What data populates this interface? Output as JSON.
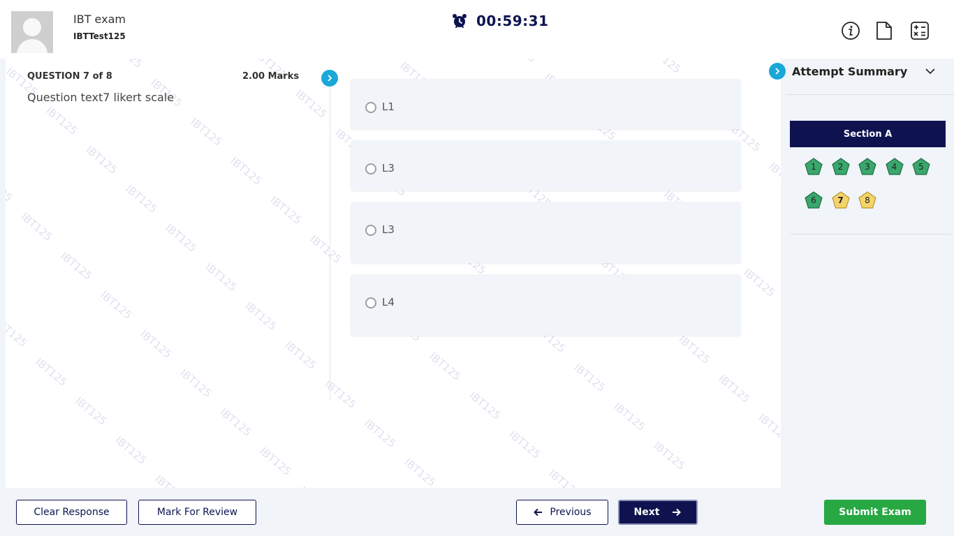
{
  "header": {
    "exam_name": "IBT exam",
    "test_id": "IBTTest125",
    "timer": "00:59:31",
    "icons": [
      "info-icon",
      "document-icon",
      "calculator-icon"
    ]
  },
  "question": {
    "label": "QUESTION 7 of 8",
    "marks": "2.00 Marks",
    "text": "Question text7 likert scale",
    "options": [
      "L1",
      "L3",
      "L3",
      "L4"
    ]
  },
  "watermark": "IBT125",
  "summary": {
    "title": "Attempt Summary",
    "section": "Section A",
    "questions": [
      {
        "n": "1",
        "status": "answered"
      },
      {
        "n": "2",
        "status": "answered"
      },
      {
        "n": "3",
        "status": "answered"
      },
      {
        "n": "4",
        "status": "answered"
      },
      {
        "n": "5",
        "status": "answered"
      },
      {
        "n": "6",
        "status": "answered"
      },
      {
        "n": "7",
        "status": "current"
      },
      {
        "n": "8",
        "status": "not-visited"
      }
    ],
    "colors": {
      "answered": "#3aa76d",
      "current": "#f5d36b",
      "not-visited": "#f5d36b"
    }
  },
  "footer": {
    "clear": "Clear Response",
    "review": "Mark For Review",
    "previous": "Previous",
    "next": "Next",
    "submit": "Submit Exam"
  }
}
